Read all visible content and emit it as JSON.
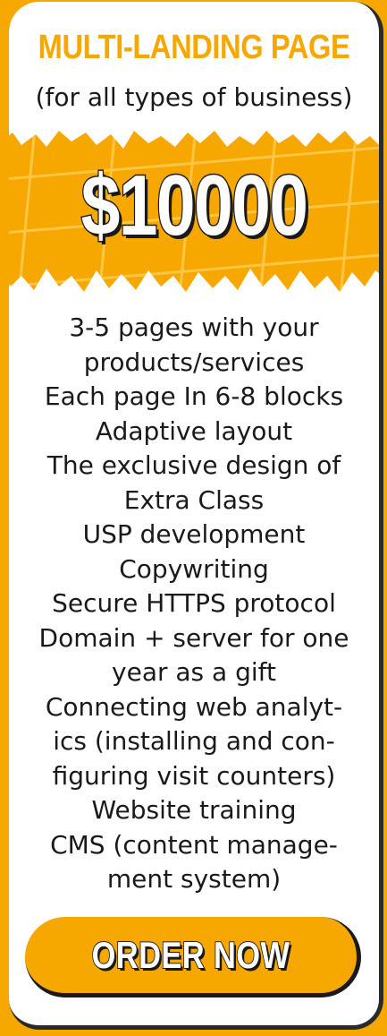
{
  "header": {
    "title": "MULTI-LANDING PAGE",
    "subtitle": "(for all types of business)"
  },
  "price": {
    "label": "$10000"
  },
  "features": [
    "3-5 pages with your",
    "products/services",
    "Each page In 6-8 blocks",
    "Adaptive layout",
    "The exclusive design of",
    "Extra Class",
    "USP development",
    "Copywriting",
    "Secure HTTPS protocol",
    "Domain + server for one",
    "year as a gift",
    "Connecting web analyt-",
    "ics (installing and con-",
    "figuring visit counters)",
    "Website training",
    "CMS (content manage-",
    "ment system)"
  ],
  "cta": {
    "label": "ORDER NOW"
  },
  "colors": {
    "accent": "#f7a800",
    "background": "#f7a800",
    "card": "#ffffff",
    "outline": "#1a1a1a"
  }
}
